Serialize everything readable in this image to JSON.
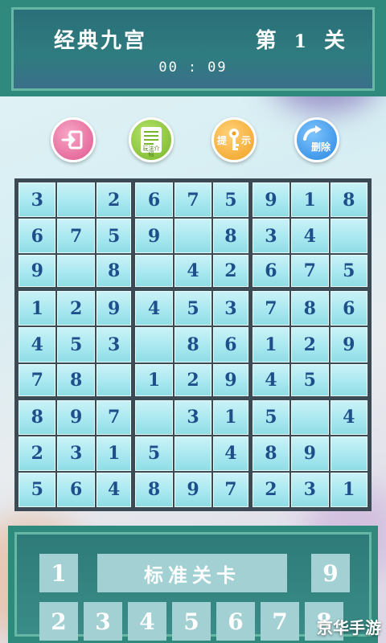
{
  "header": {
    "title": "经典九宫",
    "level_prefix": "第",
    "level_number": "1",
    "level_suffix": "关",
    "timer_minutes": "00",
    "timer_separator": ":",
    "timer_seconds": "09"
  },
  "tools": {
    "exit_icon": "exit-icon",
    "rules_label": "玩法介绍",
    "hint_label_left": "提",
    "hint_label_right": "示",
    "delete_label": "删除"
  },
  "board": {
    "rows": [
      [
        "3",
        "",
        "2",
        "6",
        "7",
        "5",
        "9",
        "1",
        "8"
      ],
      [
        "6",
        "7",
        "5",
        "9",
        "",
        "8",
        "3",
        "4",
        ""
      ],
      [
        "9",
        "",
        "8",
        "",
        "4",
        "2",
        "6",
        "7",
        "5"
      ],
      [
        "1",
        "2",
        "9",
        "4",
        "5",
        "3",
        "7",
        "8",
        "6"
      ],
      [
        "4",
        "5",
        "3",
        "",
        "8",
        "6",
        "1",
        "2",
        "9"
      ],
      [
        "7",
        "8",
        "",
        "1",
        "2",
        "9",
        "4",
        "5",
        ""
      ],
      [
        "8",
        "9",
        "7",
        "",
        "3",
        "1",
        "5",
        "",
        "4"
      ],
      [
        "2",
        "3",
        "1",
        "5",
        "",
        "4",
        "8",
        "9",
        ""
      ],
      [
        "5",
        "6",
        "4",
        "8",
        "9",
        "7",
        "2",
        "3",
        "1"
      ]
    ]
  },
  "keypad": {
    "mode_label": "标准关卡",
    "top_left": "1",
    "top_right": "9",
    "keys": [
      "2",
      "3",
      "4",
      "5",
      "6",
      "7",
      "8"
    ]
  },
  "watermark": "京华手游",
  "colors": {
    "header_bg": "#2a6f78",
    "cell_bg": "#a6e7ef",
    "digit": "#1f4f8a",
    "key_bg": "#a2d0d3"
  }
}
